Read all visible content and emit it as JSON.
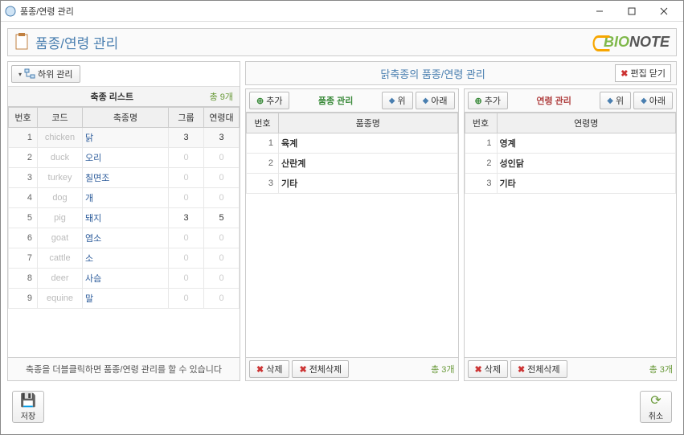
{
  "window": {
    "title": "품종/연령 관리"
  },
  "header": {
    "title": "품종/연령 관리",
    "brand1": "BIO",
    "brand2": "NOTE"
  },
  "left": {
    "sub_btn": "하위 관리",
    "title": "축종 리스트",
    "count": "총 9개",
    "cols": {
      "no": "번호",
      "code": "코드",
      "name": "축종명",
      "group": "그룹",
      "age": "연령대"
    },
    "rows": [
      {
        "no": "1",
        "code": "chicken",
        "name": "닭",
        "group": "3",
        "age": "3",
        "sel": true
      },
      {
        "no": "2",
        "code": "duck",
        "name": "오리",
        "group": "0",
        "age": "0"
      },
      {
        "no": "3",
        "code": "turkey",
        "name": "칠면조",
        "group": "0",
        "age": "0"
      },
      {
        "no": "4",
        "code": "dog",
        "name": "개",
        "group": "0",
        "age": "0"
      },
      {
        "no": "5",
        "code": "pig",
        "name": "돼지",
        "group": "3",
        "age": "5"
      },
      {
        "no": "6",
        "code": "goat",
        "name": "염소",
        "group": "0",
        "age": "0"
      },
      {
        "no": "7",
        "code": "cattle",
        "name": "소",
        "group": "0",
        "age": "0"
      },
      {
        "no": "8",
        "code": "deer",
        "name": "사슴",
        "group": "0",
        "age": "0"
      },
      {
        "no": "9",
        "code": "equine",
        "name": "말",
        "group": "0",
        "age": "0"
      }
    ],
    "hint": "축종을 더블클릭하면 품종/연령 관리를 할 수 있습니다"
  },
  "right": {
    "header": "닭축종의 품종/연령 관리",
    "close_edit": "편집 닫기",
    "breed": {
      "add": "추가",
      "title": "품종 관리",
      "up": "위",
      "down": "아래",
      "cols": {
        "no": "번호",
        "name": "품종명"
      },
      "rows": [
        {
          "no": "1",
          "name": "육계"
        },
        {
          "no": "2",
          "name": "산란계"
        },
        {
          "no": "3",
          "name": "기타"
        }
      ],
      "del": "삭제",
      "del_all": "전체삭제",
      "count": "총 3개"
    },
    "age": {
      "add": "추가",
      "title": "연령 관리",
      "up": "위",
      "down": "아래",
      "cols": {
        "no": "번호",
        "name": "연령명"
      },
      "rows": [
        {
          "no": "1",
          "name": "영계"
        },
        {
          "no": "2",
          "name": "성인닭"
        },
        {
          "no": "3",
          "name": "기타"
        }
      ],
      "del": "삭제",
      "del_all": "전체삭제",
      "count": "총 3개"
    }
  },
  "bottom": {
    "save": "저장",
    "cancel": "취소"
  }
}
